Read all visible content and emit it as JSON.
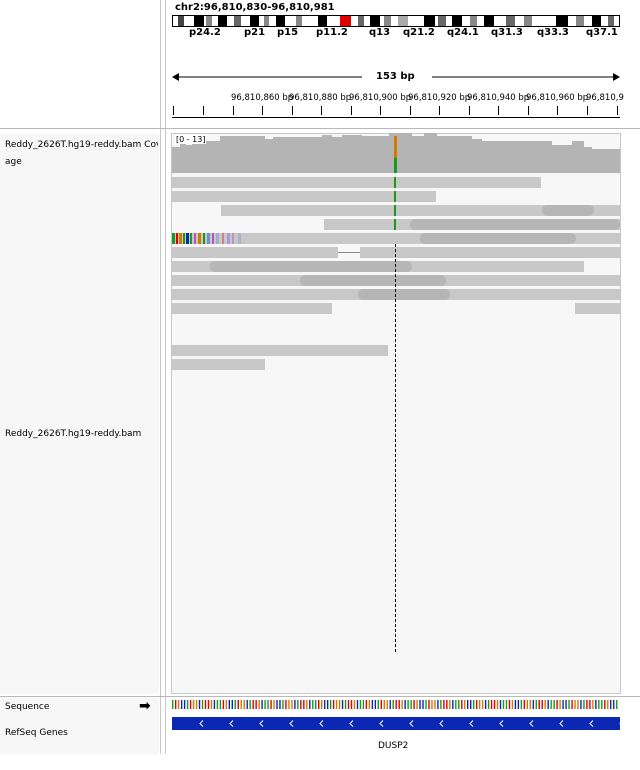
{
  "locus": "chr2:96,810,830-96,810,981",
  "cytobands": [
    "p24.2",
    "p21",
    "p15",
    "p11.2",
    "q13",
    "q21.2",
    "q24.1",
    "q31.3",
    "q33.3",
    "q37.1"
  ],
  "span_label": "153 bp",
  "ruler_ticks": [
    "96,810,860 bp",
    "96,810,880 bp",
    "96,810,900 bp",
    "96,810,920 bp",
    "96,810,940 bp",
    "96,810,960 bp",
    "96,810,9"
  ],
  "tracks": {
    "coverage_label": "Reddy_2626T.hg19-reddy.bam Coverage",
    "coverage_range": "[0 - 13]",
    "alignment_label": "Reddy_2626T.hg19-reddy.bam",
    "sequence_label": "Sequence",
    "refseq_label": "RefSeq Genes",
    "gene_name": "DUSP2"
  },
  "colors": {
    "coverage": "#b4b4b4",
    "read": "#c8c8c8",
    "gene": "#0a28b4",
    "centromere": "#e00000",
    "mismatch_top": "#d07a00",
    "mismatch_bottom": "#1a9a1a"
  }
}
